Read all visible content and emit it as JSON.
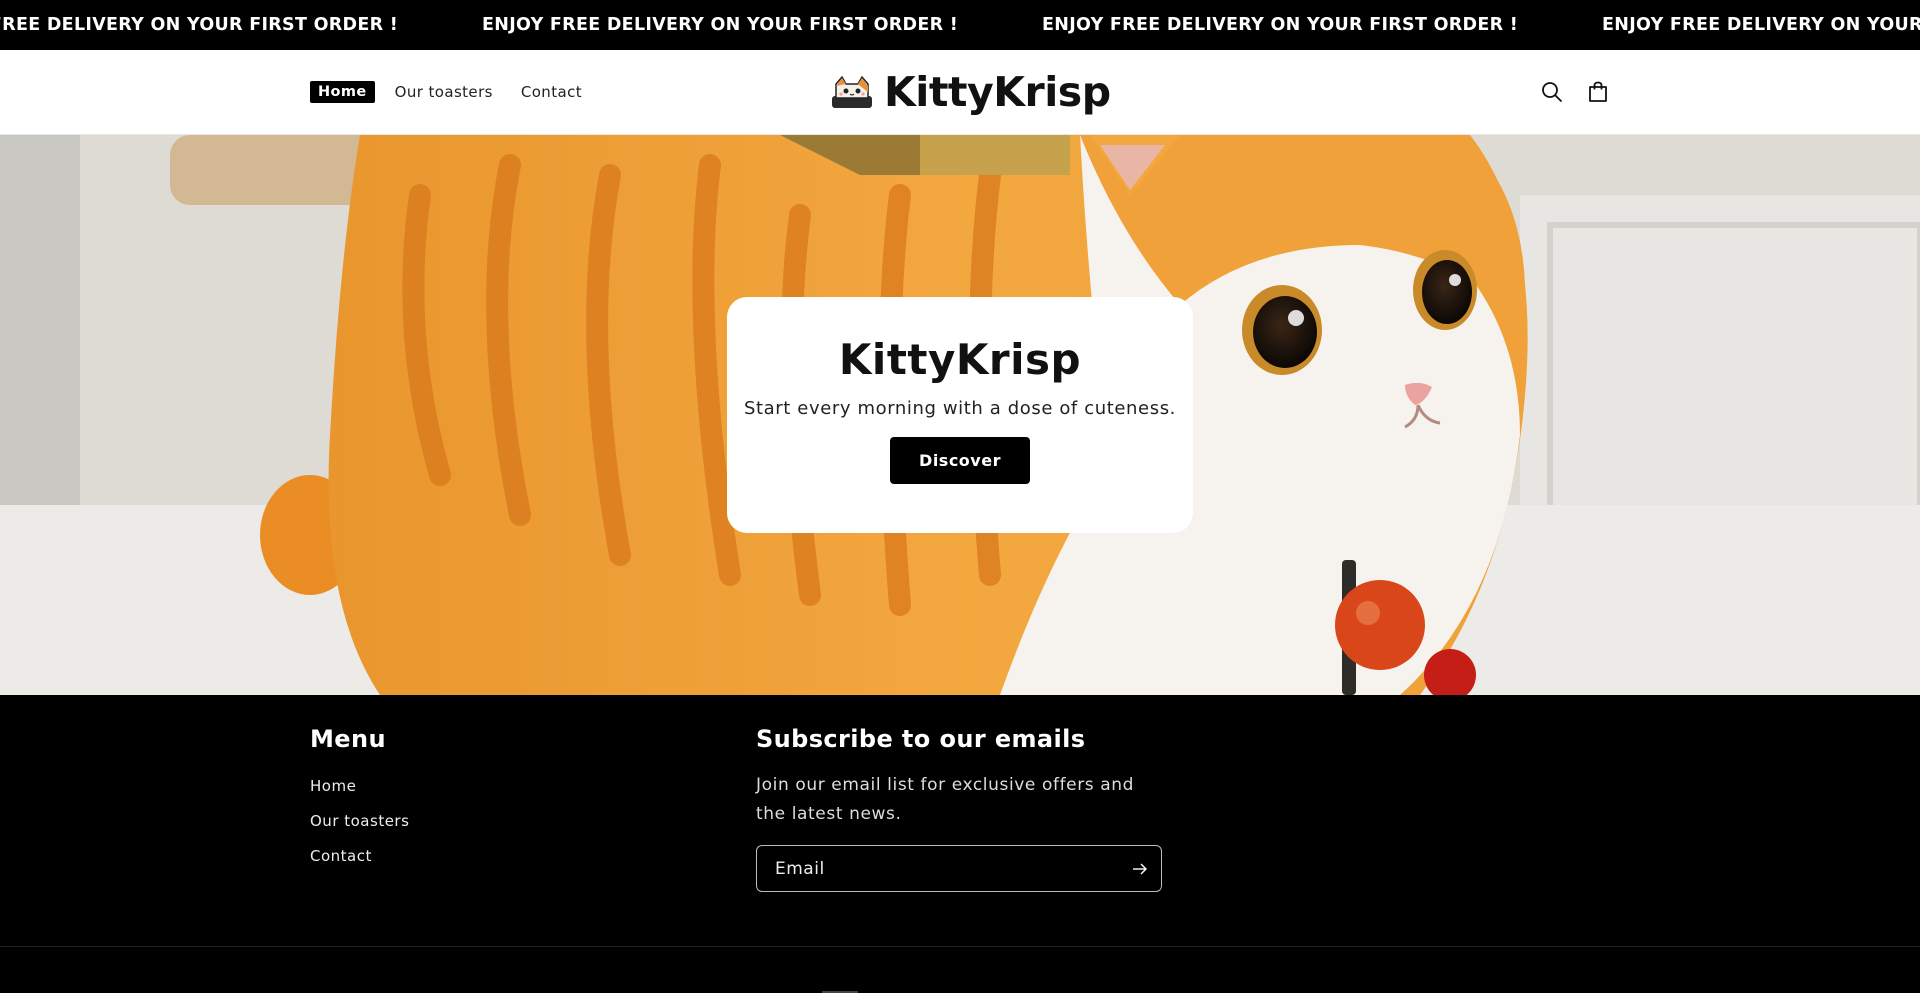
{
  "announcement": {
    "messages": [
      "ENJOY FREE DELIVERY ON YOUR FIRST ORDER !",
      "ENJOY FREE DELIVERY ON YOUR FIRST ORDER !",
      "ENJOY FREE DELIVERY ON YOUR FIRST ORDER !",
      "ENJOY FREE DELIVERY ON YOUR FIRST ORDER !"
    ]
  },
  "header": {
    "nav": [
      {
        "label": "Home",
        "active": true
      },
      {
        "label": "Our toasters",
        "active": false
      },
      {
        "label": "Contact",
        "active": false
      }
    ],
    "logo_text": "KittyKrisp",
    "icons": [
      "search-icon",
      "cart-icon"
    ]
  },
  "hero": {
    "title": "KittyKrisp",
    "subtitle": "Start every morning with a dose of cuteness.",
    "button_label": "Discover"
  },
  "footer": {
    "menu_heading": "Menu",
    "menu_items": [
      "Home",
      "Our toasters",
      "Contact"
    ],
    "subscribe_heading": "Subscribe to our emails",
    "subscribe_text": "Join our email list for exclusive offers and the latest news.",
    "email_placeholder": "Email"
  },
  "colors": {
    "background": "#000000",
    "header_bg": "#ffffff",
    "cat_orange": "#f0a53a",
    "cat_white": "#f7f4ef"
  }
}
